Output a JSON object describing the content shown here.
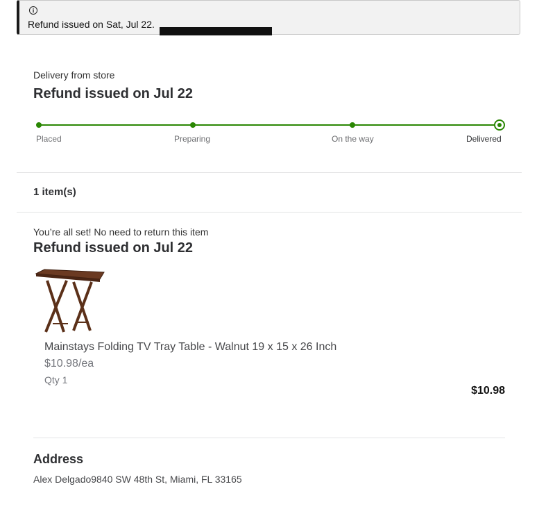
{
  "alert": {
    "icon": "info-icon",
    "text": "Refund issued on Sat, Jul 22."
  },
  "order_status": {
    "subtitle": "Delivery from store",
    "title": "Refund issued on Jul 22",
    "progress_color": "#2a8703",
    "steps": [
      {
        "label": "Placed",
        "complete": true
      },
      {
        "label": "Preparing",
        "complete": true
      },
      {
        "label": "On the way",
        "complete": true
      },
      {
        "label": "Delivered",
        "complete": true,
        "current": true
      }
    ]
  },
  "items_section": {
    "count_label": "1 item(s)"
  },
  "item_group": {
    "note": "You’re all set! No need to return this item",
    "title": "Refund issued on Jul 22",
    "product": {
      "image": "folding-tray-table-image",
      "name": "Mainstays Folding TV Tray Table - Walnut 19 x 15 x 26 Inch",
      "unit_price": "$10.98/ea",
      "quantity": "Qty 1",
      "total": "$10.98"
    }
  },
  "address": {
    "heading": "Address",
    "line": "Alex Delgado9840 SW 48th St, Miami, FL 33165"
  }
}
